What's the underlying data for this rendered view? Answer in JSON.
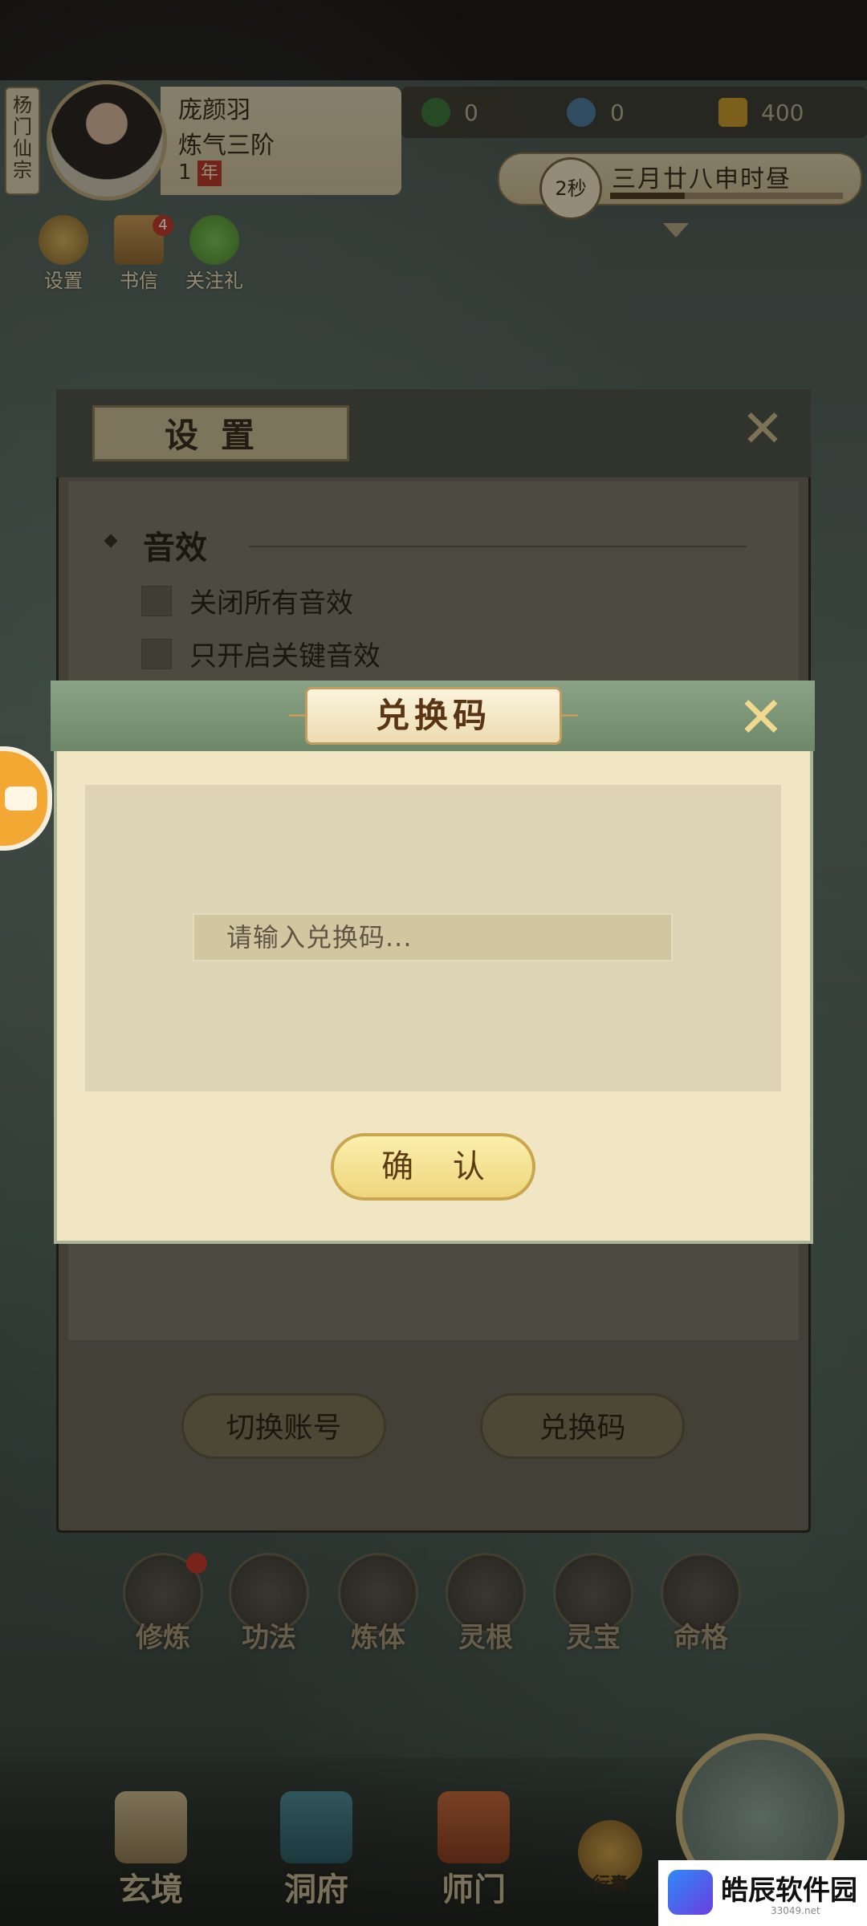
{
  "player": {
    "sect": "杨门仙宗",
    "name": "庞颜羽",
    "realm": "炼气三阶",
    "year_value": "1",
    "year_unit": "年"
  },
  "resources": [
    {
      "icon": "jade-icon",
      "value": "0"
    },
    {
      "icon": "coin-icon",
      "value": "0"
    },
    {
      "icon": "gold-ingot-icon",
      "value": "400"
    }
  ],
  "time": {
    "countdown": "2秒",
    "date": "三月廿八申时昼",
    "progress": 0.32
  },
  "hud_buttons": [
    {
      "label": "设置",
      "icon": "gear-icon"
    },
    {
      "label": "书信",
      "icon": "letter-icon",
      "badge": "4"
    },
    {
      "label": "关注礼",
      "icon": "gift-icon"
    }
  ],
  "settings": {
    "title": "设置",
    "section_sound": "音效",
    "options": [
      "关闭所有音效",
      "只开启关键音效"
    ],
    "switch_account": "切换账号",
    "redeem_code": "兑换码"
  },
  "redeem": {
    "title": "兑换码",
    "placeholder": "请输入兑换码...",
    "value": "",
    "confirm": "确 认"
  },
  "skills": [
    "修炼",
    "功法",
    "炼体",
    "灵根",
    "灵宝",
    "命格"
  ],
  "nav": [
    "玄境",
    "洞府",
    "师门",
    "行囊"
  ],
  "watermark": {
    "name": "皓辰软件园",
    "url": "33049.net"
  },
  "colors": {
    "dialog_bg": "#f0e6c4",
    "confirm_bg": "#f3de88",
    "header_green": "#7c9678",
    "accent_gold": "#c29b5e"
  }
}
